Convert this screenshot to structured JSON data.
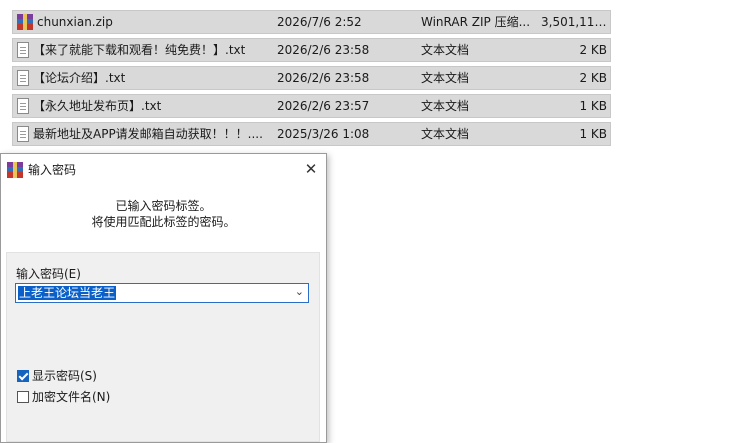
{
  "files": [
    {
      "name": "chunxian.zip",
      "date": "2026/7/6 2:52",
      "type": "WinRAR ZIP 压缩...",
      "size": "3,501,110...",
      "icon": "rar-archive-icon"
    },
    {
      "name": "【来了就能下载和观看！纯免费！】.txt",
      "date": "2026/2/6 23:58",
      "type": "文本文档",
      "size": "2 KB",
      "icon": "text-file-icon"
    },
    {
      "name": "【论坛介绍】.txt",
      "date": "2026/2/6 23:58",
      "type": "文本文档",
      "size": "2 KB",
      "icon": "text-file-icon"
    },
    {
      "name": "【永久地址发布页】.txt",
      "date": "2026/2/6 23:57",
      "type": "文本文档",
      "size": "1 KB",
      "icon": "text-file-icon"
    },
    {
      "name": "最新地址及APP请发邮箱自动获取！！！....",
      "date": "2025/3/26 1:08",
      "type": "文本文档",
      "size": "1 KB",
      "icon": "text-file-icon"
    }
  ],
  "dialog": {
    "title": "输入密码",
    "close_glyph": "✕",
    "message_line1": "已输入密码标签。",
    "message_line2": "将使用匹配此标签的密码。",
    "password_label": "输入密码(E)",
    "password_value": "上老王论坛当老王",
    "show_password_label": "显示密码(S)",
    "show_password_checked": true,
    "encrypt_names_label": "加密文件名(N)",
    "encrypt_names_checked": false
  }
}
